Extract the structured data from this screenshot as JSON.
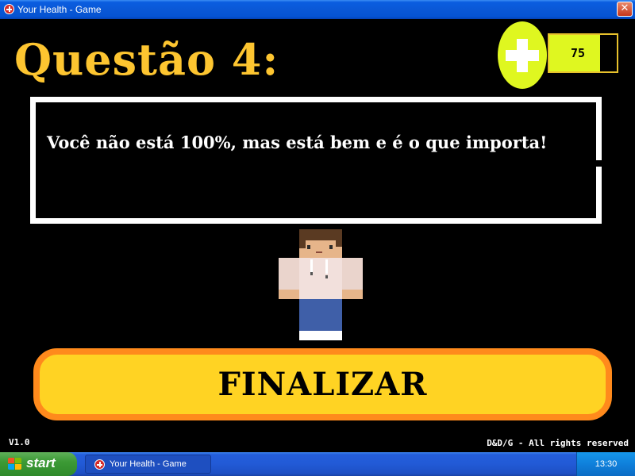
{
  "window": {
    "title": "Your Health - Game",
    "close_label": "✕"
  },
  "game": {
    "question_title": "Questão 4:",
    "health": {
      "value_label": "75",
      "fill_percent": 75,
      "bar_color": "#dff720"
    },
    "message": "Você não está 100%, mas está bem e é o que importa!",
    "finish_button": {
      "label": "FINALIZAR",
      "fill_color": "#ffd323",
      "border_color": "#ff8a1c"
    },
    "version": "V1.0",
    "copyright": "D&D/G - All rights reserved",
    "title_color": "#fdc530"
  },
  "taskbar": {
    "start_label": "start",
    "task_label": "Your Health - Game",
    "clock": "13:30"
  },
  "icons": {
    "app": "red-cross-icon",
    "health": "plus-icon",
    "start": "windows-logo-icon",
    "close": "close-icon"
  }
}
